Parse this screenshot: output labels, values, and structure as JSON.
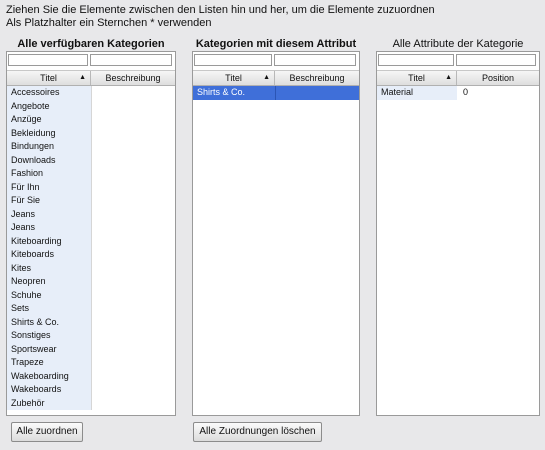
{
  "instructions": {
    "line1": "Ziehen Sie die Elemente zwischen den Listen hin und her, um die Elemente zuzuordnen",
    "line2": "Als Platzhalter ein Sternchen * verwenden"
  },
  "available": {
    "title": "Alle verfügbaren Kategorien",
    "filter_title": "",
    "filter_description": "",
    "columns": [
      "Titel",
      "Beschreibung"
    ],
    "rows": [
      {
        "title": "Accessoires",
        "description": ""
      },
      {
        "title": "Angebote",
        "description": ""
      },
      {
        "title": "Anzüge",
        "description": ""
      },
      {
        "title": "Bekleidung",
        "description": ""
      },
      {
        "title": "Bindungen",
        "description": ""
      },
      {
        "title": "Downloads",
        "description": ""
      },
      {
        "title": "Fashion",
        "description": ""
      },
      {
        "title": "Für Ihn",
        "description": ""
      },
      {
        "title": "Für Sie",
        "description": ""
      },
      {
        "title": "Jeans",
        "description": ""
      },
      {
        "title": "Jeans",
        "description": ""
      },
      {
        "title": "Kiteboarding",
        "description": ""
      },
      {
        "title": "Kiteboards",
        "description": ""
      },
      {
        "title": "Kites",
        "description": ""
      },
      {
        "title": "Neopren",
        "description": ""
      },
      {
        "title": "Schuhe",
        "description": ""
      },
      {
        "title": "Sets",
        "description": ""
      },
      {
        "title": "Shirts & Co.",
        "description": ""
      },
      {
        "title": "Sonstiges",
        "description": ""
      },
      {
        "title": "Sportswear",
        "description": ""
      },
      {
        "title": "Trapeze",
        "description": ""
      },
      {
        "title": "Wakeboarding",
        "description": ""
      },
      {
        "title": "Wakeboards",
        "description": ""
      },
      {
        "title": "Zubehör",
        "description": ""
      }
    ],
    "button": "Alle zuordnen"
  },
  "assigned": {
    "title": "Kategorien mit diesem Attribut",
    "filter_title": "",
    "filter_description": "",
    "columns": [
      "Titel",
      "Beschreibung"
    ],
    "rows": [
      {
        "title": "Shirts & Co.",
        "description": "",
        "selected": true
      }
    ],
    "button": "Alle Zuordnungen löschen"
  },
  "attributes": {
    "title": "Alle Attribute der Kategorie",
    "filter_title": "",
    "filter_position": "",
    "columns": [
      "Titel",
      "Position"
    ],
    "rows": [
      {
        "title": "Material",
        "position": "0"
      }
    ]
  },
  "colors": {
    "selection": "#3f6fd9",
    "stripe": "#e7eef9",
    "background": "#e8e8ea"
  }
}
